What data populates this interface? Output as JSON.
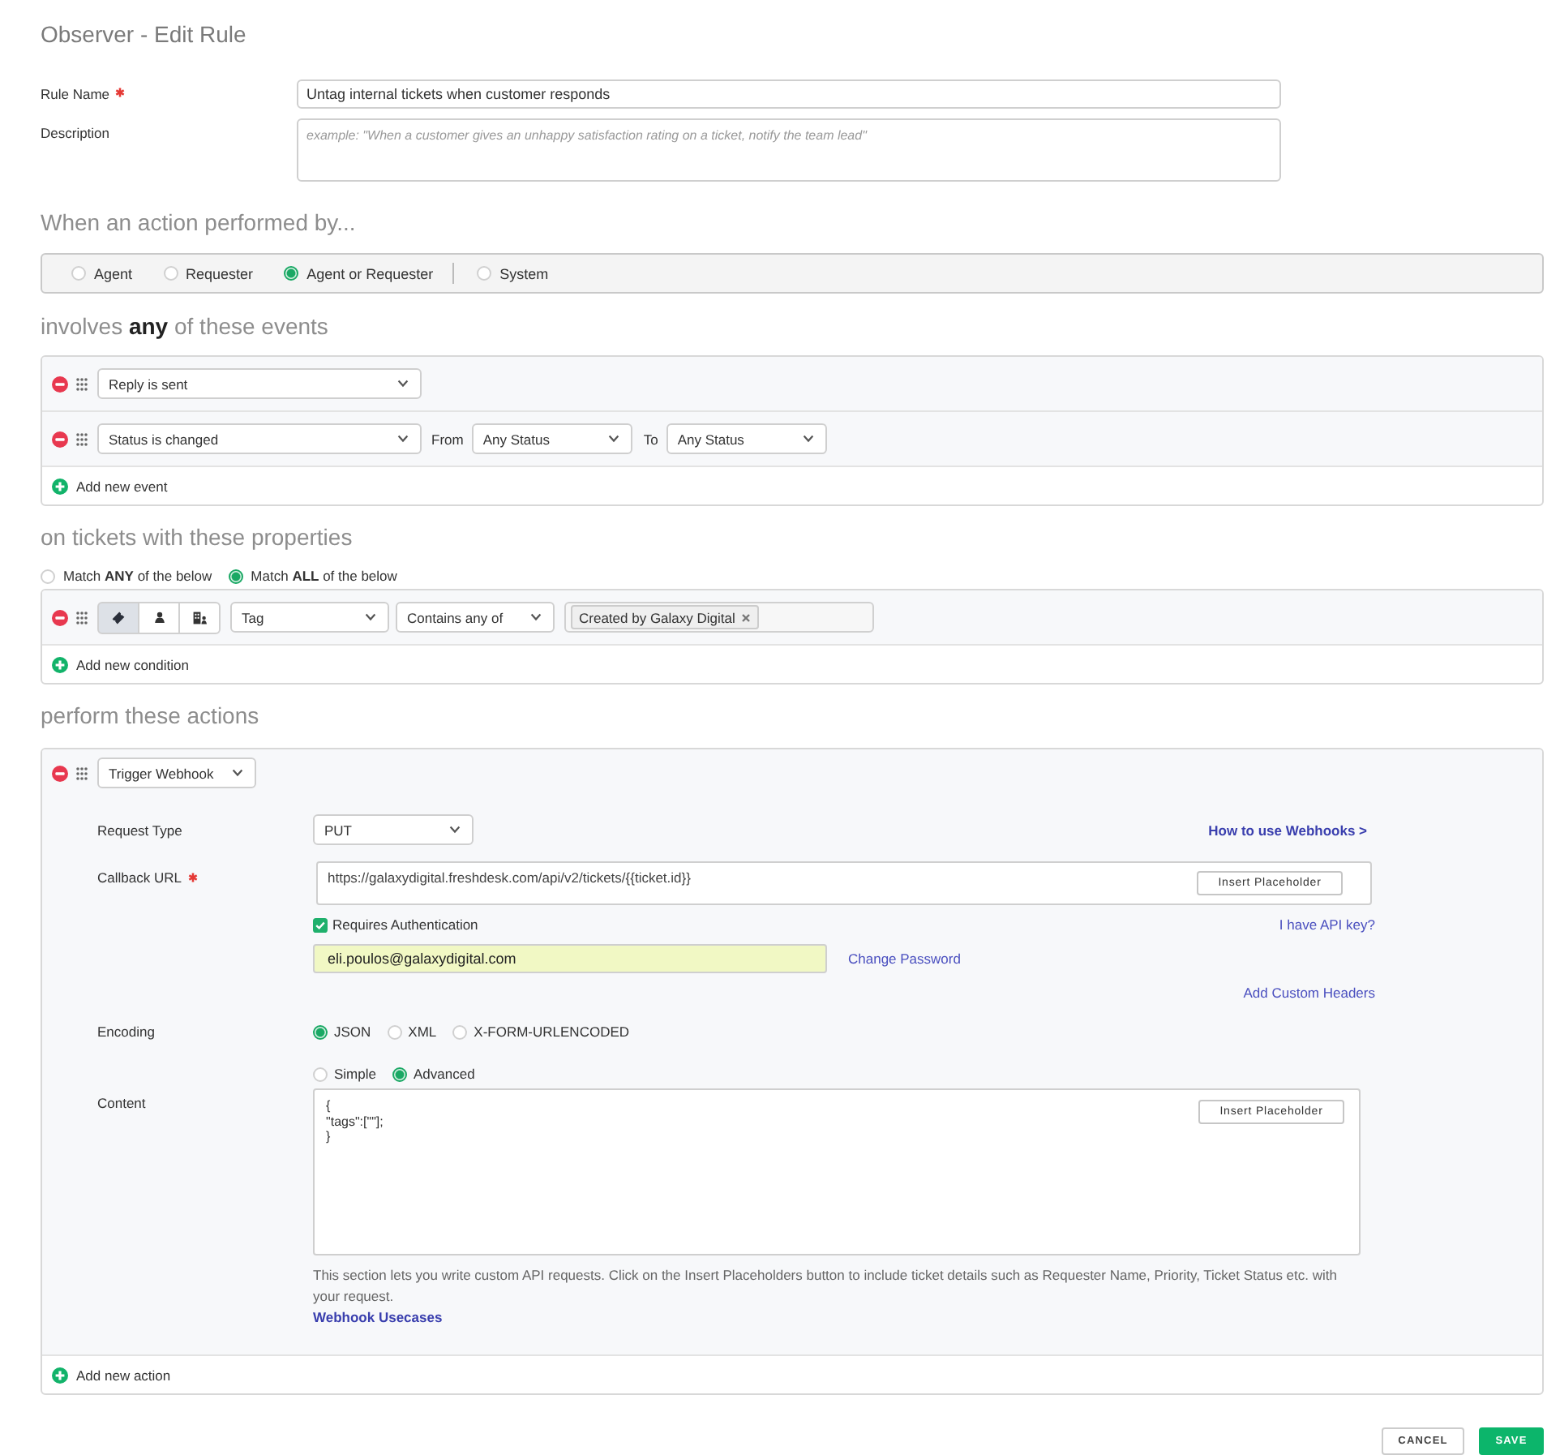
{
  "page": {
    "title": "Observer - Edit Rule"
  },
  "rule_name": {
    "label": "Rule Name",
    "required": true,
    "value": "Untag internal tickets when customer responds"
  },
  "description": {
    "label": "Description",
    "placeholder": "example: \"When a customer gives an unhappy satisfaction rating on a ticket, notify the team lead\""
  },
  "performed_by": {
    "heading": "When an action performed by...",
    "options": [
      {
        "label": "Agent",
        "selected": false
      },
      {
        "label": "Requester",
        "selected": false
      },
      {
        "label": "Agent or Requester",
        "selected": true
      },
      {
        "label": "System",
        "selected": false
      }
    ]
  },
  "events": {
    "heading": "involves **any** of these events",
    "rows": [
      {
        "event": "Reply is sent"
      },
      {
        "event": "Status is changed",
        "from_label": "From",
        "from": "Any Status",
        "to_label": "To",
        "to": "Any Status"
      }
    ],
    "add_label": "Add new event"
  },
  "conditions": {
    "heading": "on tickets with these properties",
    "match": [
      {
        "label": "Match **ANY** of the below",
        "selected": false
      },
      {
        "label": "Match **ALL** of the below",
        "selected": true
      }
    ],
    "rows": [
      {
        "scope": [
          {
            "kind": "ticket",
            "selected": true
          },
          {
            "kind": "person",
            "selected": false
          },
          {
            "kind": "company",
            "selected": false
          }
        ],
        "field": "Tag",
        "operator": "Contains any of",
        "values": [
          "Created by Galaxy Digital"
        ]
      }
    ],
    "add_label": "Add new condition"
  },
  "actions": {
    "heading": "perform these actions",
    "rows": [
      {
        "action": "Trigger Webhook",
        "webhook": {
          "request_type": {
            "label": "Request Type",
            "value": "PUT"
          },
          "help_link": "How to use Webhooks >",
          "callback_url": {
            "label": "Callback URL",
            "required": true,
            "value": "https://galaxydigital.freshdesk.com/api/v2/tickets/{{ticket.id}}",
            "button": "Insert Placeholder"
          },
          "auth": {
            "label": "Requires Authentication",
            "checked": true,
            "api_key_link": "I have API key?",
            "username": "eli.poulos@galaxydigital.com",
            "password_link": "Change Password"
          },
          "custom_headers_link": "Add Custom Headers",
          "encoding": {
            "label": "Encoding",
            "options": [
              {
                "label": "JSON",
                "selected": true
              },
              {
                "label": "XML",
                "selected": false
              },
              {
                "label": "X-FORM-URLENCODED",
                "selected": false
              }
            ]
          },
          "content": {
            "label": "Content",
            "modes": [
              {
                "label": "Simple",
                "selected": false
              },
              {
                "label": "Advanced",
                "selected": true
              }
            ],
            "value": "{\n\"tags\":[\"\"];\n}",
            "button": "Insert Placeholder",
            "help": "This section lets you write custom API requests. Click on the Insert Placeholders button to include ticket details such as Requester Name, Priority, Ticket Status etc. with your request.",
            "help_link": "Webhook Usecases"
          }
        }
      }
    ],
    "add_label": "Add new action"
  },
  "footer_buttons": [
    {
      "label": "CANCEL",
      "kind": "secondary"
    },
    {
      "label": "SAVE",
      "kind": "primary"
    }
  ]
}
